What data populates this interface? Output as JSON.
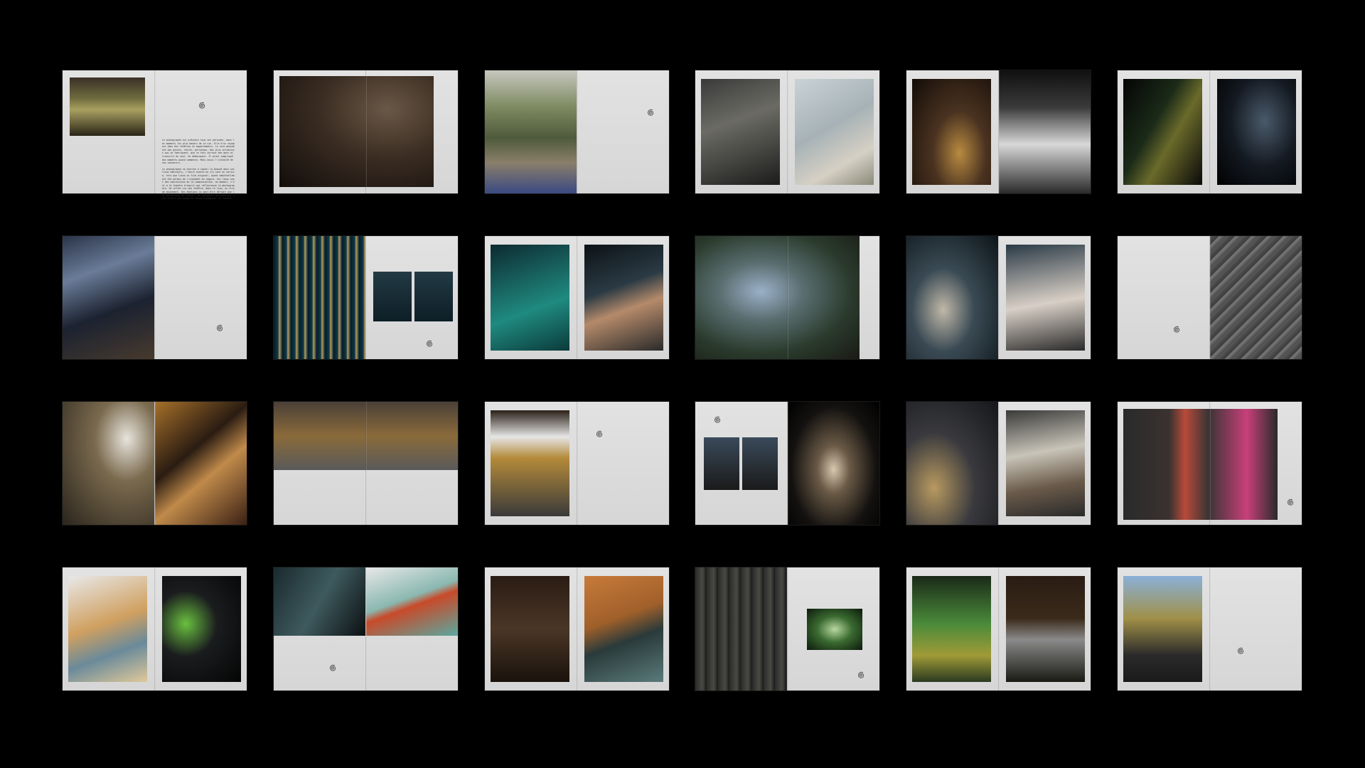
{
  "gallery": {
    "spread_count": 24,
    "caption_paragraph_1": "Le photographe est présente tous ses périodes, dans les moments les plus banals de la vie. Elle d'un voyageur dans des fenêtres et appartements. Le rare mouvement des gestes, récits, personnes, des plus intimistes qui se fabriquent, que ce fait surtout des gens et transcrit du seul. Un débarquant. Il plait compliqué des moments quand commence. Mais aussi l'intimité de nos souvenirs.",
    "caption_paragraph_2": "Le photographe ne cherche à capter la beauté dans ses lieux habituels, l'heure exacte où ils sont en service, tels que lieux un film original, ayant habituellement été perdus de l'alphabet du regard. Ces lieux sont des expressions de la communication. Au moment, c'est à la lumière d'esprit qui réflexionne la photographie. Un reflet sur une fenêtre, dans le lieu, un clin de mouvement. Des émotions ou peut-être défiant que les mystérieux de trouver. On rencontre un grand qui nous trouve une nouvelle façon d'imaginer la lumière."
  },
  "colors": {
    "background": "#000000",
    "paper": "#dcdcdc",
    "ink": "#333333"
  },
  "icons": {
    "swirl": "spiral-doodle-icon"
  }
}
